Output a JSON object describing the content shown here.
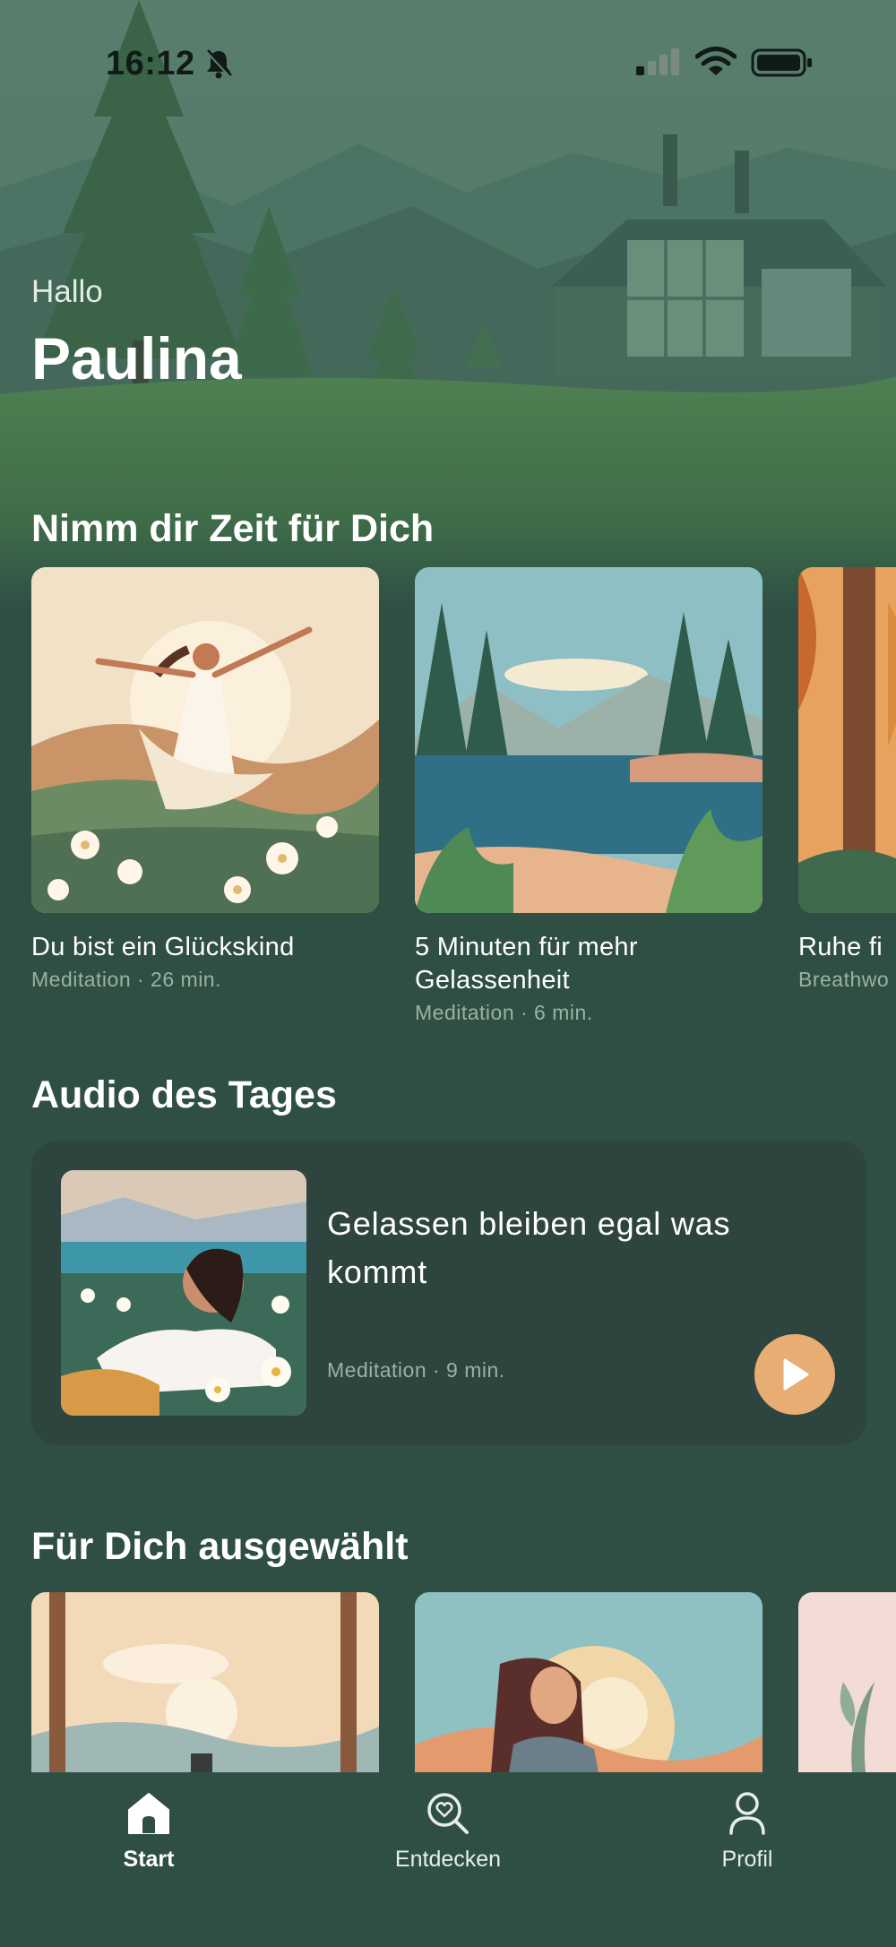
{
  "status_bar": {
    "time": "16:12"
  },
  "greeting": {
    "hello": "Hallo",
    "name": "Paulina"
  },
  "sections": {
    "take_time": {
      "title": "Nimm dir Zeit für Dich",
      "cards": [
        {
          "title": "Du bist ein Glückskind",
          "meta": "Meditation · 26 min."
        },
        {
          "title": "5 Minuten für mehr Gelassenheit",
          "meta": "Meditation · 6 min."
        },
        {
          "title": "Ruhe fi",
          "meta": "Breathwo"
        }
      ]
    },
    "audio_of_day": {
      "title": "Audio des Tages",
      "item": {
        "title": "Gelassen bleiben egal was kommt",
        "meta": "Meditation · 9 min."
      }
    },
    "selected": {
      "title": "Für Dich ausgewählt"
    }
  },
  "tabbar": {
    "items": [
      {
        "label": "Start",
        "icon": "home-icon",
        "active": true
      },
      {
        "label": "Entdecken",
        "icon": "discover-search-heart-icon",
        "active": false
      },
      {
        "label": "Profil",
        "icon": "profile-icon",
        "active": false
      }
    ]
  },
  "colors": {
    "background": "#2f4f45",
    "card": "#2e443e",
    "accent": "#e7ad72",
    "meta_text": "#9bb29f"
  }
}
